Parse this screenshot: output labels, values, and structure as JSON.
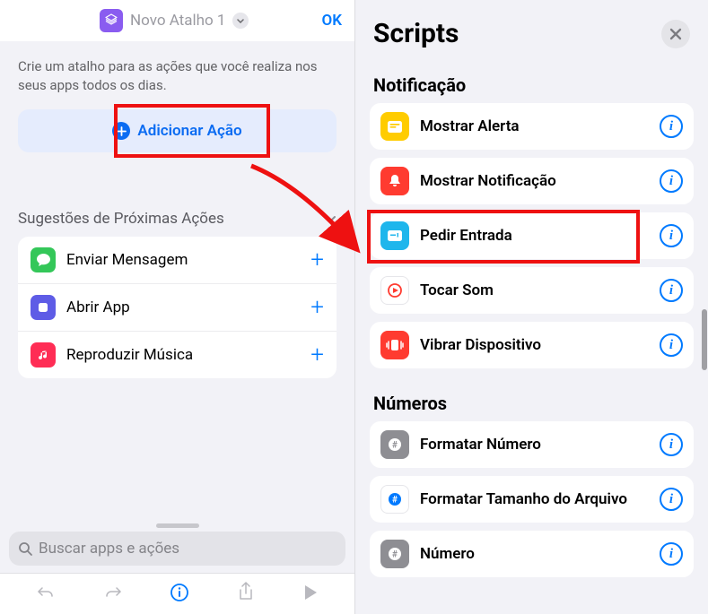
{
  "left": {
    "shortcut_name": "Novo Atalho 1",
    "ok_label": "OK",
    "prompt": "Crie um atalho para as ações que você realiza nos seus apps todos os dias.",
    "add_action_label": "Adicionar Ação",
    "suggestions_header": "Sugestões de Próximas Ações",
    "suggestions": [
      {
        "label": "Enviar Mensagem",
        "icon_bg": "#34c759"
      },
      {
        "label": "Abrir App",
        "icon_bg": "#5e5ce6"
      },
      {
        "label": "Reproduzir Música",
        "icon_bg": "#ff2d55"
      }
    ],
    "search_placeholder": "Buscar apps e ações"
  },
  "right": {
    "title": "Scripts",
    "sections": [
      {
        "title": "Notificação",
        "items": [
          {
            "label": "Mostrar Alerta",
            "icon_bg": "#ffcc00",
            "icon": "alert"
          },
          {
            "label": "Mostrar Notificação",
            "icon_bg": "#ff3b30",
            "icon": "bell"
          },
          {
            "label": "Pedir Entrada",
            "icon_bg": "#1fb6ec",
            "icon": "input",
            "highlight": true
          },
          {
            "label": "Tocar Som",
            "icon_bg": "#ffffff",
            "icon": "play"
          },
          {
            "label": "Vibrar Dispositivo",
            "icon_bg": "#ff3b30",
            "icon": "vibrate"
          }
        ]
      },
      {
        "title": "Números",
        "items": [
          {
            "label": "Formatar Número",
            "icon_bg": "#8e8e93",
            "icon": "hash"
          },
          {
            "label": "Formatar Tamanho do Arquivo",
            "icon_bg": "#ffffff",
            "icon": "hash-blue"
          },
          {
            "label": "Número",
            "icon_bg": "#8e8e93",
            "icon": "hash"
          }
        ]
      }
    ]
  }
}
